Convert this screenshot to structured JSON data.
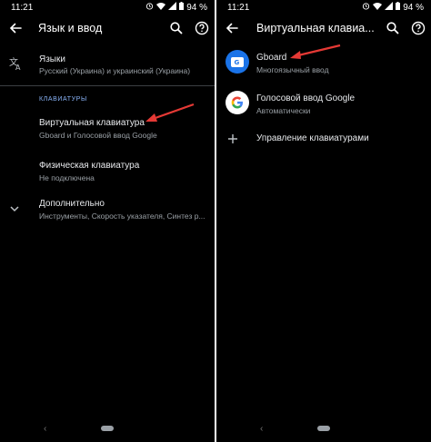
{
  "left": {
    "status": {
      "time": "11:21",
      "battery": "94 %"
    },
    "appbar": {
      "title": "Язык и ввод"
    },
    "languages": {
      "title": "Языки",
      "subtitle": "Русский (Украина) и украинский (Украина)"
    },
    "keyboards_header": "КЛАВИАТУРЫ",
    "virtual_keyboard": {
      "title": "Виртуальная клавиатура",
      "subtitle": "Gboard и Голосовой ввод Google"
    },
    "physical_keyboard": {
      "title": "Физическая клавиатура",
      "subtitle": "Не подключена"
    },
    "advanced": {
      "title": "Дополнительно",
      "subtitle": "Инструменты, Скорость указателя, Синтез р..."
    }
  },
  "right": {
    "status": {
      "time": "11:21",
      "battery": "94 %"
    },
    "appbar": {
      "title": "Виртуальная клавиа..."
    },
    "gboard": {
      "title": "Gboard",
      "subtitle": "Многоязычный ввод"
    },
    "voice": {
      "title": "Голосовой ввод Google",
      "subtitle": "Автоматически"
    },
    "manage": {
      "title": "Управление клавиатурами"
    }
  },
  "colors": {
    "background": "#000000",
    "accent": "#8ab4f8",
    "arrow": "#e53935",
    "gboard_blue": "#1a73e8"
  }
}
